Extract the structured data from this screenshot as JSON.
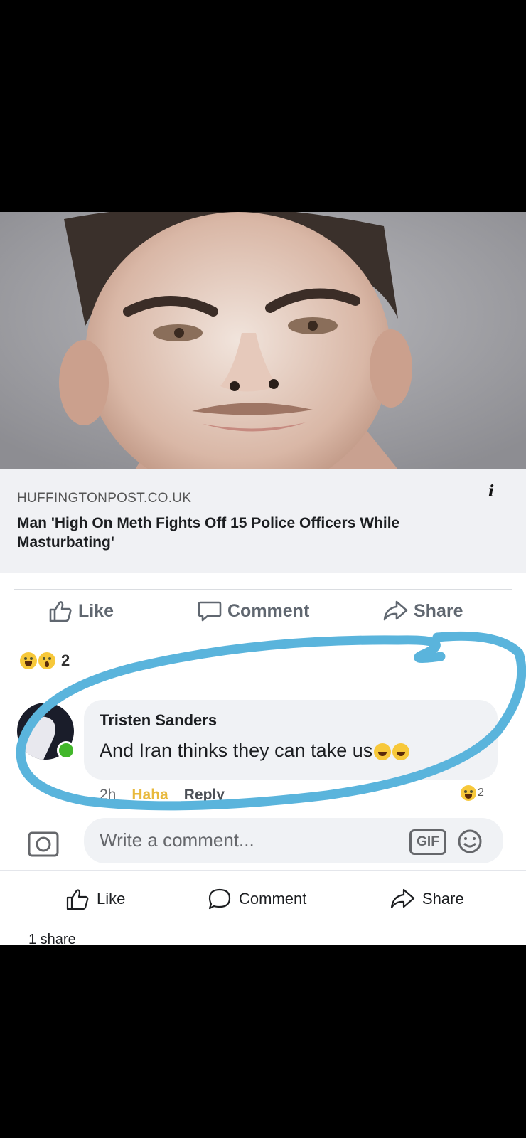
{
  "link": {
    "domain": "HUFFINGTONPOST.CO.UK",
    "title": "Man 'High On Meth Fights Off 15 Police Officers While Masturbating'",
    "info_icon": "info-icon"
  },
  "post_actions": {
    "like": "Like",
    "comment": "Comment",
    "share": "Share"
  },
  "reactions": {
    "icons": [
      "haha-emoji",
      "wow-emoji"
    ],
    "count": "2"
  },
  "comment": {
    "author": "Tristen Sanders",
    "text": "And Iran thinks they can take us",
    "time": "2h",
    "haha_label": "Haha",
    "reply_label": "Reply",
    "reaction_count": "2"
  },
  "composer": {
    "placeholder": "Write a comment...",
    "gif_label": "GIF"
  },
  "bottom_actions": {
    "like": "Like",
    "comment": "Comment",
    "share": "Share"
  },
  "shares_text": "1 share",
  "colors": {
    "marker": "#5ab4dc",
    "online": "#42b72a",
    "haha": "#e8b93c"
  }
}
